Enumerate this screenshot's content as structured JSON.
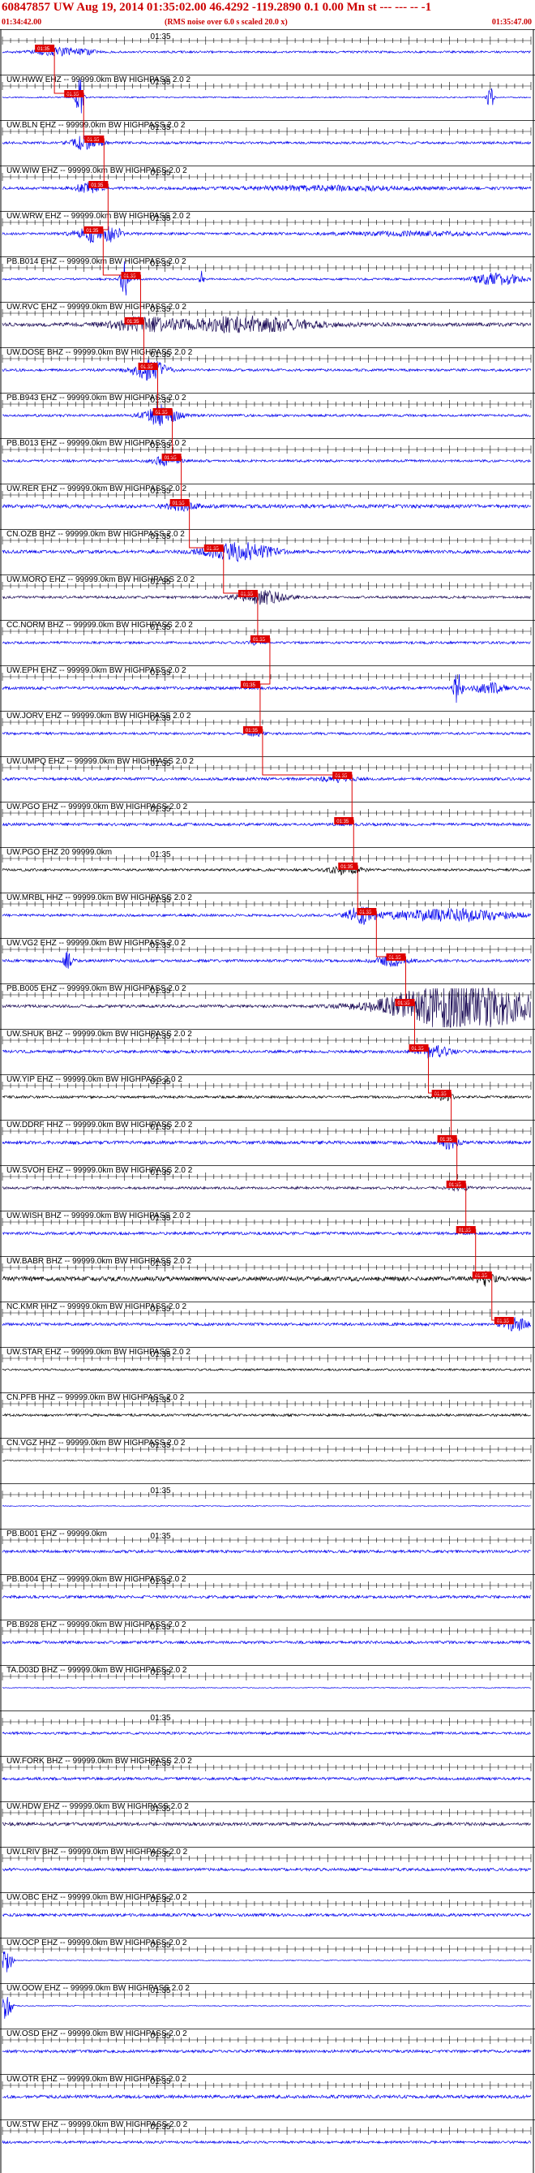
{
  "header": {
    "title": "60847857 UW Aug 19, 2014 01:35:02.00   46.4292 -119.2890  0.1 0.00 Mn st --- --- --   -1",
    "start_time": "01:34:42.00",
    "note": "(RMS noise over 6.0 s scaled 20.0 x)",
    "end_time": "01:35:47.00",
    "color": "#cc0000"
  },
  "chart_data": {
    "type": "line",
    "title": "60847857 UW Aug 19, 2014 01:35:02.00",
    "xlim_seconds": [
      0,
      65
    ],
    "tick_interval_seconds": 1,
    "minute_mark_label": "01:35",
    "minute_mark_second": 18,
    "pick_label": "01:35",
    "colors": {
      "blue": "#0000ee",
      "navy": "#1a0a55",
      "black": "#000000",
      "pick": "#dd0000",
      "grid": "#000000"
    },
    "traces": [
      {
        "label": "",
        "color": "blue",
        "amp": 0.25,
        "events": [
          [
            7,
            3.0,
            0.9
          ],
          [
            10,
            1.5,
            0.4
          ]
        ],
        "pick": 4.0
      },
      {
        "label": "UW.HWW EHZ -- 99999.0km BW HIGHPASS  2.0  2",
        "color": "blue",
        "amp": 0.15,
        "events": [
          [
            9.5,
            0.4,
            6
          ],
          [
            60,
            0.4,
            3
          ]
        ],
        "pick": 7.6
      },
      {
        "label": "UW.BLN EHZ -- 99999.0km BW HIGHPASS  2.0  2",
        "color": "blue",
        "amp": 0.3,
        "events": [
          [
            10,
            1.5,
            1.3
          ],
          [
            11,
            2,
            0.6
          ]
        ],
        "pick": 10.1
      },
      {
        "label": "UW.WIW EHZ -- 99999.0km BW HIGHPASS  2.0  2",
        "color": "blue",
        "amp": 0.35,
        "events": [
          [
            10.5,
            1.5,
            1.2
          ],
          [
            40,
            10,
            0.5
          ]
        ],
        "pick": 10.6
      },
      {
        "label": "UW.WRW EHZ -- 99999.0km BW HIGHPASS  2.0  2",
        "color": "blue",
        "amp": 0.3,
        "events": [
          [
            12,
            2.5,
            2.5
          ],
          [
            50,
            10,
            0.4
          ]
        ],
        "pick": 10.0
      },
      {
        "label": "PB.B014 EHZ -- 99999.0km BW HIGHPASS  2.0  2",
        "color": "blue",
        "amp": 0.25,
        "events": [
          [
            15,
            0.4,
            6
          ],
          [
            24.5,
            0.2,
            4
          ],
          [
            61,
            3,
            1.5
          ]
        ],
        "pick": 14.6
      },
      {
        "label": "UW.RVC EHZ -- 99999.0km BW HIGHPASS  2.0  2",
        "color": "navy",
        "amp": 0.45,
        "events": [
          [
            17,
            4,
            1.5
          ],
          [
            30,
            8,
            1.8
          ]
        ],
        "pick": 15.0
      },
      {
        "label": "UW.DOSE BHZ -- 99999.0km BW HIGHPASS  2.0  2",
        "color": "blue",
        "amp": 0.3,
        "events": [
          [
            18,
            2,
            2.5
          ]
        ],
        "pick": 16.7
      },
      {
        "label": "PB.B943 EHZ -- 99999.0km BW HIGHPASS  2.0  2",
        "color": "blue",
        "amp": 0.3,
        "events": [
          [
            19.5,
            2,
            2.5
          ]
        ],
        "pick": 18.5
      },
      {
        "label": "PB.B013 EHZ -- 99999.0km BW HIGHPASS  2.0  2",
        "color": "blue",
        "amp": 0.3,
        "events": [
          [
            20,
            1.5,
            1.2
          ]
        ],
        "pick": 19.6
      },
      {
        "label": "UW.RER EHZ -- 99999.0km BW HIGHPASS  2.0  2",
        "color": "blue",
        "amp": 0.45,
        "events": [
          [
            22,
            2,
            0.8
          ]
        ],
        "pick": 20.6
      },
      {
        "label": "CN.OZB BHZ -- 99999.0km BW HIGHPASS  2.0  2",
        "color": "blue",
        "amp": 0.4,
        "events": [
          [
            29,
            4,
            2.2
          ]
        ],
        "pick": 24.8
      },
      {
        "label": "UW.MORO EHZ -- 99999.0km BW HIGHPASS  2.0  2",
        "color": "navy",
        "amp": 0.3,
        "events": [
          [
            32,
            3,
            1.6
          ]
        ],
        "pick": 29.0
      },
      {
        "label": "CC.NORM BHZ -- 99999.0km BW HIGHPASS  2.0  2",
        "color": "blue",
        "amp": 0.3,
        "events": [
          [
            30.7,
            0.4,
            0.5
          ]
        ],
        "pick": 30.5
      },
      {
        "label": "UW.EPH EHZ -- 99999.0km BW HIGHPASS  2.0  2",
        "color": "blue",
        "amp": 0.35,
        "events": [
          [
            56,
            0.5,
            4
          ],
          [
            60,
            2,
            1.2
          ]
        ],
        "pick": 29.3
      },
      {
        "label": "UW.JORV EHZ -- 99999.0km BW HIGHPASS  2.0  2",
        "color": "blue",
        "amp": 0.3,
        "events": [
          [
            31,
            1,
            0.6
          ]
        ],
        "pick": 29.6
      },
      {
        "label": "UW.UMPQ EHZ -- 99999.0km BW HIGHPASS  2.0  2",
        "color": "blue",
        "amp": 0.35,
        "events": [
          [
            41,
            2,
            0.6
          ]
        ],
        "pick": 40.6
      },
      {
        "label": "UW.PGO EHZ -- 99999.0km BW HIGHPASS  2.0  2",
        "color": "blue",
        "amp": 0.35,
        "events": [],
        "pick": 40.8
      },
      {
        "label": "UW.PGO EHZ 20 99999.0km",
        "color": "black",
        "amp": 0.3,
        "events": [
          [
            42,
            2,
            1.0
          ]
        ],
        "pick": 41.3
      },
      {
        "label": "UW.MRBL HHZ -- 99999.0km BW HIGHPASS  2.0  2",
        "color": "blue",
        "amp": 0.3,
        "events": [
          [
            44,
            1.5,
            2.0
          ],
          [
            55,
            8,
            1.5
          ]
        ],
        "pick": 43.6
      },
      {
        "label": "UW.VG2 EHZ -- 99999.0km BW HIGHPASS  2.0  2",
        "color": "blue",
        "amp": 0.35,
        "events": [
          [
            8,
            0.5,
            2
          ],
          [
            48,
            2,
            1.2
          ]
        ],
        "pick": 47.2
      },
      {
        "label": "PB.B005 EHZ -- 99999.0km BW HIGHPASS  2.0  2",
        "color": "navy",
        "amp": 0.35,
        "events": [
          [
            57,
            9,
            6
          ]
        ],
        "pick": 48.3
      },
      {
        "label": "UW.SHUK BHZ -- 99999.0km BW HIGHPASS  2.0  2",
        "color": "blue",
        "amp": 0.35,
        "events": [
          [
            53,
            2,
            1.5
          ]
        ],
        "pick": 50.0
      },
      {
        "label": "UW.YIP EHZ -- 99999.0km BW HIGHPASS  2.0  2",
        "color": "black",
        "amp": 0.3,
        "events": [
          [
            54.5,
            1,
            0.8
          ]
        ],
        "pick": 52.8
      },
      {
        "label": "UW.DDRF HHZ -- 99999.0km BW HIGHPASS  2.0  2",
        "color": "blue",
        "amp": 0.4,
        "events": [
          [
            55,
            1,
            1.5
          ]
        ],
        "pick": 53.5
      },
      {
        "label": "UW.SVOH EHZ -- 99999.0km BW HIGHPASS  2.0  2",
        "color": "navy",
        "amp": 0.3,
        "events": [
          [
            56,
            1.5,
            0.5
          ]
        ],
        "pick": 54.6
      },
      {
        "label": "UW.WISH BHZ -- 99999.0km BW HIGHPASS  2.0  2",
        "color": "blue",
        "amp": 0.35,
        "events": [],
        "pick": 55.8
      },
      {
        "label": "UW.BABR BHZ -- 99999.0km BW HIGHPASS  2.0  2",
        "color": "black",
        "amp": 0.55,
        "events": [
          [
            59.5,
            1,
            1.6
          ]
        ],
        "pick": 57.8
      },
      {
        "label": "NC.KMR HHZ -- 99999.0km BW HIGHPASS  2.0  2",
        "color": "blue",
        "amp": 0.35,
        "events": [
          [
            63,
            1.5,
            1.5
          ]
        ],
        "pick": 60.5
      },
      {
        "label": "UW.STAR EHZ -- 99999.0km BW HIGHPASS  2.0  2",
        "color": "black",
        "amp": 0.25,
        "events": [],
        "pick": null
      },
      {
        "label": "CN.PFB HHZ -- 99999.0km BW HIGHPASS  2.0  2",
        "color": "black",
        "amp": 0.3,
        "events": [],
        "pick": null
      },
      {
        "label": "CN.VGZ HHZ -- 99999.0km BW HIGHPASS  2.0  2",
        "color": "black",
        "amp": 0.1,
        "events": [],
        "pick": null
      },
      {
        "label": "",
        "color": "blue",
        "amp": 0.1,
        "events": [],
        "pick": null
      },
      {
        "label": "PB.B001 EHZ -- 99999.0km",
        "color": "blue",
        "amp": 0.35,
        "events": [],
        "pick": null
      },
      {
        "label": "PB.B004 EHZ -- 99999.0km BW HIGHPASS  2.0  2",
        "color": "blue",
        "amp": 0.35,
        "events": [],
        "pick": null
      },
      {
        "label": "PB.B928 EHZ -- 99999.0km BW HIGHPASS  2.0  2",
        "color": "blue",
        "amp": 0.35,
        "events": [],
        "pick": null
      },
      {
        "label": "TA.D03D BHZ -- 99999.0km BW HIGHPASS  2.0  2",
        "color": "blue",
        "amp": 0.1,
        "events": [],
        "pick": null
      },
      {
        "label": "",
        "color": "blue",
        "amp": 0.3,
        "events": [],
        "pick": null
      },
      {
        "label": "UW.FORK BHZ -- 99999.0km BW HIGHPASS  2.0  2",
        "color": "blue",
        "amp": 0.35,
        "events": [],
        "pick": null
      },
      {
        "label": "UW.HDW EHZ -- 99999.0km BW HIGHPASS  2.0  2",
        "color": "navy",
        "amp": 0.4,
        "events": [],
        "pick": null
      },
      {
        "label": "UW.LRIV BHZ -- 99999.0km BW HIGHPASS  2.0  2",
        "color": "blue",
        "amp": 0.35,
        "events": [],
        "pick": null
      },
      {
        "label": "UW.OBC EHZ -- 99999.0km BW HIGHPASS  2.0  2",
        "color": "blue",
        "amp": 0.35,
        "events": [],
        "pick": null
      },
      {
        "label": "UW.OCP EHZ -- 99999.0km BW HIGHPASS  2.0  2",
        "color": "blue",
        "amp": 0.1,
        "events": [
          [
            0.5,
            0.6,
            4
          ]
        ],
        "pick": null
      },
      {
        "label": "UW.OOW EHZ -- 99999.0km BW HIGHPASS  2.0  2",
        "color": "blue",
        "amp": 0.1,
        "events": [
          [
            0.5,
            0.6,
            4
          ]
        ],
        "pick": null
      },
      {
        "label": "UW.OSD EHZ -- 99999.0km BW HIGHPASS  2.0  2",
        "color": "blue",
        "amp": 0.35,
        "events": [],
        "pick": null
      },
      {
        "label": "UW.OTR EHZ -- 99999.0km BW HIGHPASS  2.0  2",
        "color": "blue",
        "amp": 0.4,
        "events": [],
        "pick": null
      },
      {
        "label": "UW.STW EHZ -- 99999.0km BW HIGHPASS  2.0  2",
        "color": "blue",
        "amp": 0.3,
        "events": [],
        "pick": null
      }
    ]
  }
}
